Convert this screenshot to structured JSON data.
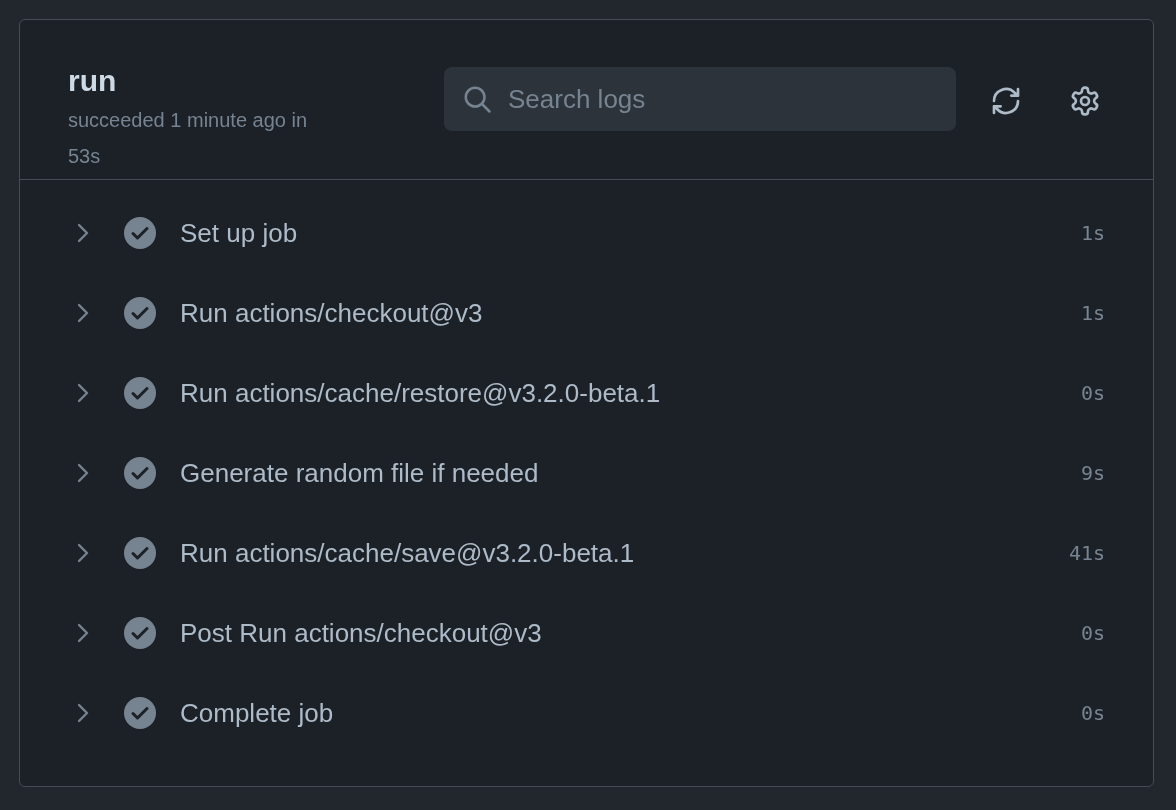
{
  "job": {
    "title": "run",
    "summary": "succeeded 1 minute ago in 53s"
  },
  "search": {
    "placeholder": "Search logs"
  },
  "steps": [
    {
      "name": "Set up job",
      "duration": "1s"
    },
    {
      "name": "Run actions/checkout@v3",
      "duration": "1s"
    },
    {
      "name": "Run actions/cache/restore@v3.2.0-beta.1",
      "duration": "0s"
    },
    {
      "name": "Generate random file if needed",
      "duration": "9s"
    },
    {
      "name": "Run actions/cache/save@v3.2.0-beta.1",
      "duration": "41s"
    },
    {
      "name": "Post Run actions/checkout@v3",
      "duration": "0s"
    },
    {
      "name": "Complete job",
      "duration": "0s"
    }
  ]
}
